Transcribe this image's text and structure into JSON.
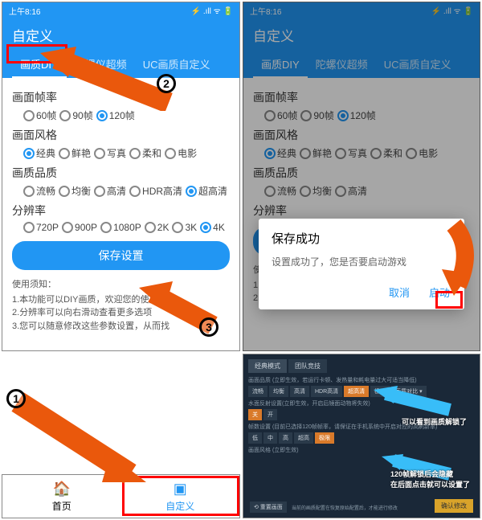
{
  "status": {
    "time": "上午8:16",
    "icons": "⚡ ᯤ ⚡ 📶 🔋"
  },
  "header": {
    "title": "自定义"
  },
  "tabs": {
    "diy": "画质DIY",
    "gyro": "陀螺仪超频",
    "uc": "UC画质自定义"
  },
  "frame": {
    "title": "画面帧率",
    "o60": "60帧",
    "o90": "90帧",
    "o120": "120帧"
  },
  "style": {
    "title": "画面风格",
    "classic": "经典",
    "vivid": "鲜艳",
    "photo": "写真",
    "soft": "柔和",
    "movie": "电影"
  },
  "quality": {
    "title": "画质品质",
    "smooth": "流畅",
    "balanced": "均衡",
    "hd": "高清",
    "hdr": "HDR高清",
    "uhd": "超高清"
  },
  "res": {
    "title": "分辨率",
    "r720": "720P",
    "r900": "900P",
    "r1080": "1080P",
    "r2k": "2K",
    "r3k": "3K",
    "r4k": "4K"
  },
  "save": "保存设置",
  "notes": {
    "title": "使用须知：",
    "l1": "1.本功能可以DIY画质，欢迎您的使用",
    "l2": "2.分辨率可以向右滑动查看更多选项",
    "l3": "3.您可以随意修改这些参数设置，从而找"
  },
  "dialog": {
    "title": "保存成功",
    "msg": "设置成功了，您是否要启动游戏",
    "cancel": "取消",
    "launch": "启动"
  },
  "nav": {
    "home": "首页",
    "custom": "自定义"
  },
  "game": {
    "tab1": "经典模式",
    "tab2": "团队竞技",
    "row1": "画面品质 (立即生效，若运行卡顿、发热量和耗电量过大可适当降低)",
    "o1": "流畅",
    "o2": "均衡",
    "o3": "高清",
    "o4": "HDR高清",
    "o5": "超高清",
    "o6": "极清",
    "o7": "画质对比 ▾",
    "row2": "水面反射设置(立即生效，开启后镜面动物将失效)",
    "w1": "关",
    "w2": "开",
    "row3": "帧数设置 (目前已选择120帧帧率，请保证在手机系统中开启对应的高刷新率)",
    "f1": "低",
    "f2": "中",
    "f3": "高",
    "f4": "超高",
    "f5": "极限",
    "row4": "画面风格 (立即生效)",
    "confirm": "确认修改",
    "reset": "⟲ 重置画面",
    "hint": "当前的画质配置在恢复原始配置后，才能进行修改"
  },
  "anno": {
    "a1": "可以看到画质解锁了",
    "a2": "120帧解锁后会隐藏\n在后面点击就可以设置了"
  }
}
